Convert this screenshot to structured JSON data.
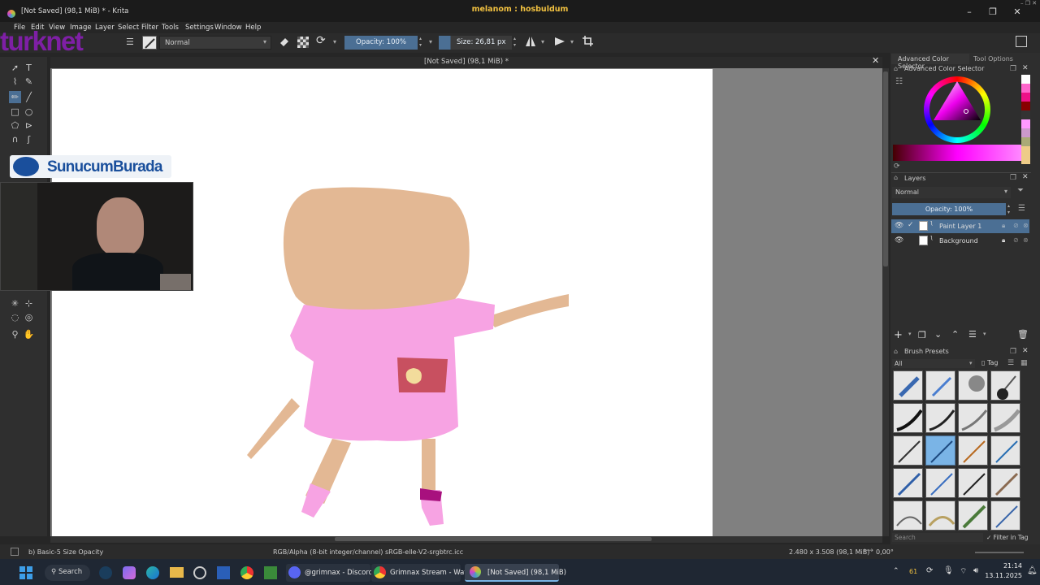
{
  "window": {
    "app_title": "[Not Saved]  (98,1 MiB) * - Krita",
    "stream_title": "melanom : hosbuldum",
    "controls": [
      "–",
      "❐",
      "✕"
    ]
  },
  "menu": [
    "File",
    "Edit",
    "View",
    "Image",
    "Layer",
    "Select",
    "Filter",
    "Tools",
    "Settings",
    "Window",
    "Help"
  ],
  "toolbar": {
    "blend_mode": "Normal",
    "opacity": "Opacity: 100%",
    "size": "Size: 26,81 px"
  },
  "document": {
    "title": "[Not Saved]  (98,1 MiB) *"
  },
  "overlay": {
    "logo": "turknet",
    "sponsor": "SunucumBurada"
  },
  "right_dock": {
    "tabs": [
      "Advanced Color Selector",
      "Tool Options"
    ],
    "color_panel_title": "Advanced Color Selector",
    "layers_title": "Layers",
    "layers_blend": "Normal",
    "layers_opacity": "Opacity:  100%",
    "layers": [
      {
        "name": "Paint Layer 1",
        "selected": true
      },
      {
        "name": "Background",
        "selected": false
      }
    ],
    "brush_title": "Brush Presets",
    "brush_filter": "All",
    "brush_tag": "Tag",
    "search_placeholder": "Search",
    "filter_in_tag": "Filter in Tag"
  },
  "status": {
    "brush": "b) Basic-5 Size Opacity",
    "color_space": "RGB/Alpha (8-bit integer/channel)  sRGB-elle-V2-srgbtrc.icc",
    "dimensions": "2.480 x 3.508 (98,1 MiB)",
    "rotation": "0,00°"
  },
  "taskbar": {
    "search": "Search",
    "discord": "@grimnax - Discord",
    "chrome": "Grimnax Stream - Watcl",
    "krita": "[Not Saved]  (98,1 MiB)",
    "temp": "61",
    "time": "21:14",
    "date": "13.11.2025"
  },
  "colors": {
    "accent": "#4b6f94",
    "shirt": "#f7a3e3",
    "skin": "#e3b894"
  }
}
